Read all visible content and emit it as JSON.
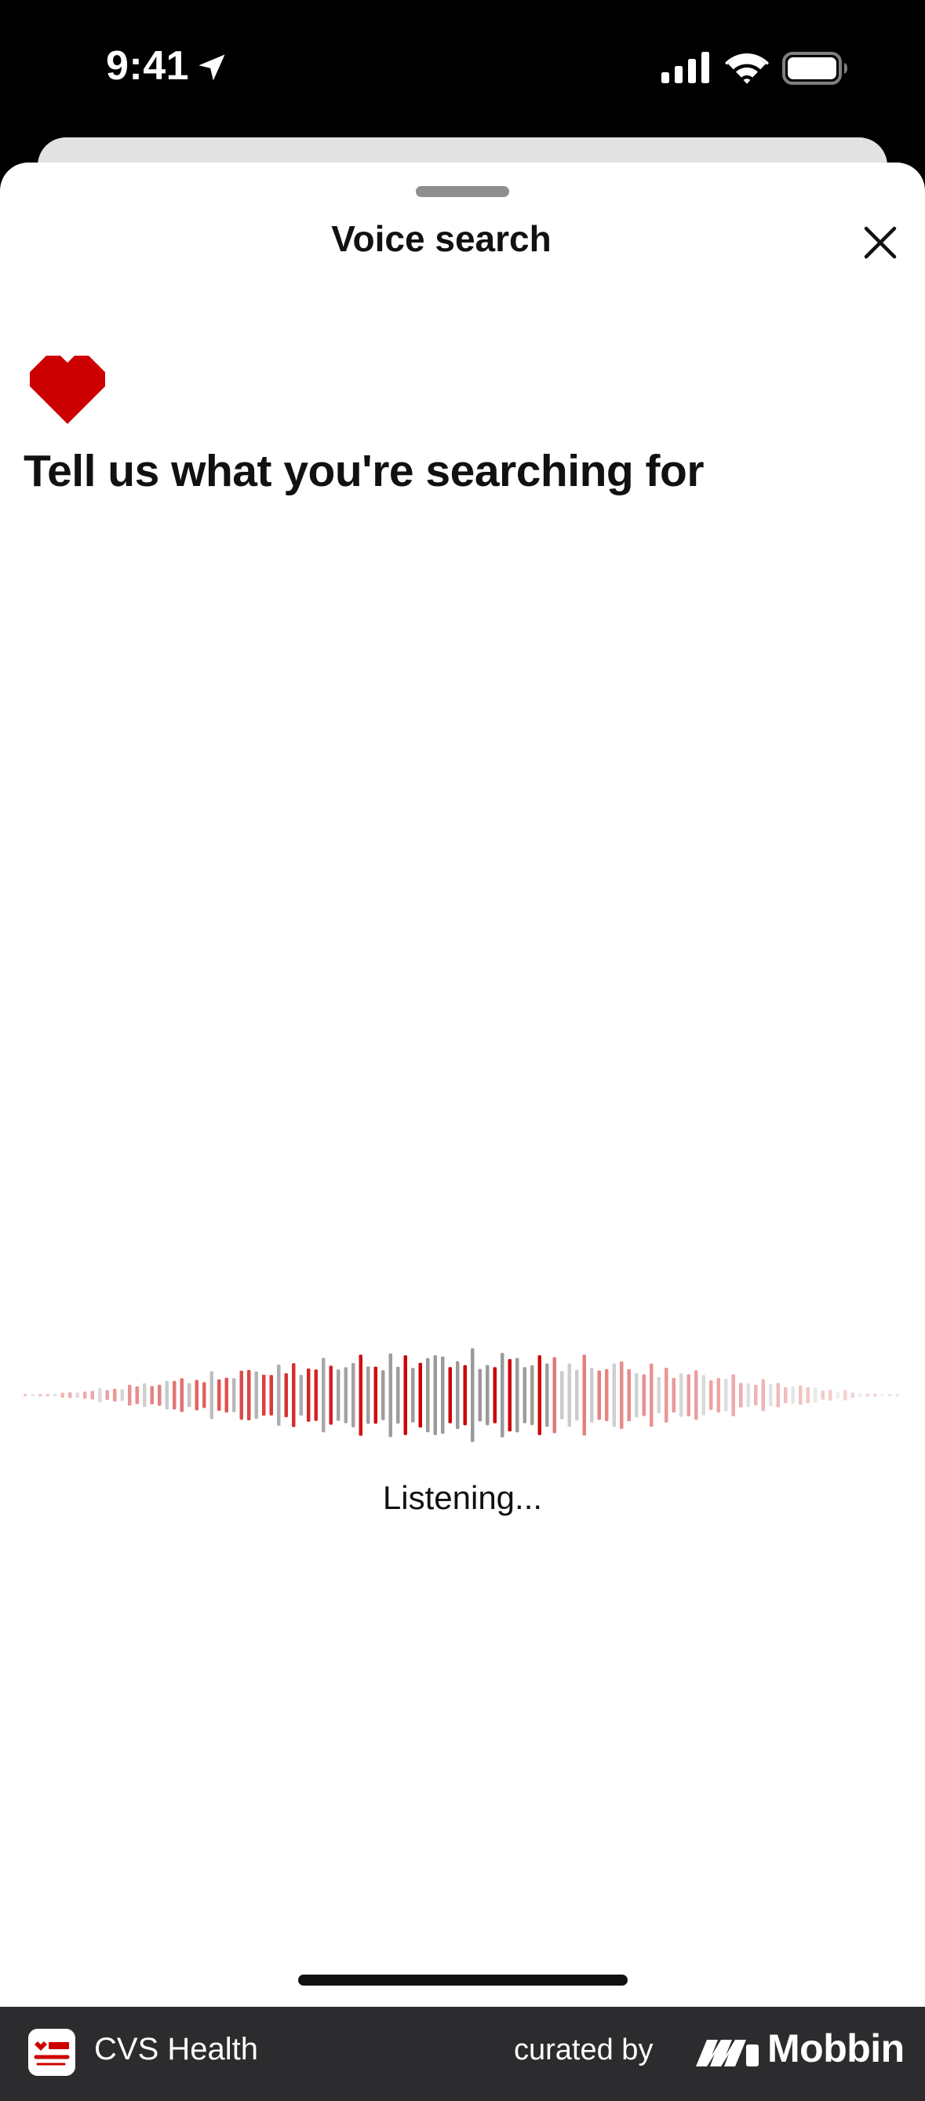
{
  "status_bar": {
    "time": "9:41",
    "icons": [
      "location-arrow-icon",
      "cellular-signal-icon",
      "wifi-icon",
      "battery-icon"
    ]
  },
  "sheet": {
    "title": "Voice search",
    "close_icon": "close-icon",
    "logo_icon": "cvs-heart-icon",
    "prompt": "Tell us what you're searching for",
    "status_text": "Listening...",
    "waveform_icon": "audio-waveform-icon"
  },
  "footer": {
    "app_name": "CVS Health",
    "curated_label": "curated by",
    "brand_name": "Mobbin"
  },
  "colors": {
    "brand_red": "#CC0000",
    "text_dark": "#111111",
    "footer_bg": "#2C2C2E",
    "grabber": "#8E8E8E"
  }
}
